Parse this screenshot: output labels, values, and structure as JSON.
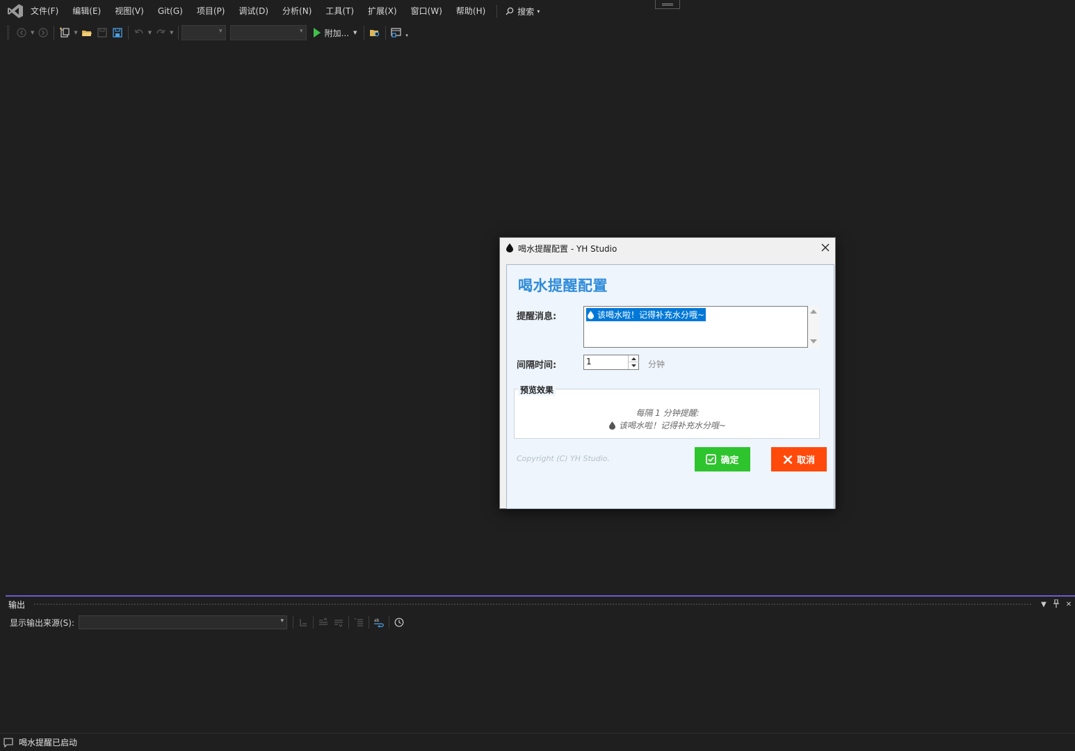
{
  "menubar": {
    "items": [
      "文件(F)",
      "编辑(E)",
      "视图(V)",
      "Git(G)",
      "项目(P)",
      "调试(D)",
      "分析(N)",
      "工具(T)",
      "扩展(X)",
      "窗口(W)",
      "帮助(H)"
    ],
    "search_label": "搜索"
  },
  "toolbar": {
    "run_label": "附加..."
  },
  "dialog": {
    "title": "喝水提醒配置 - YH Studio",
    "heading": "喝水提醒配置",
    "message_label": "提醒消息:",
    "message_value": "该喝水啦！记得补充水分哦~",
    "interval_label": "间隔时间:",
    "interval_value": "1",
    "interval_unit": "分钟",
    "preview_legend": "预览效果",
    "preview_line1": "每隔 1 分钟提醒:",
    "preview_line2": "该喝水啦！记得补充水分哦~",
    "copyright": "Copyright (C) YH Studio.",
    "ok_label": "确定",
    "cancel_label": "取消",
    "colors": {
      "heading": "#2e8bd9",
      "ok": "#2ec42e",
      "cancel": "#ff4a0c",
      "selection": "#0078d7"
    }
  },
  "output": {
    "title": "输出",
    "source_label": "显示输出来源(S):",
    "source_value": ""
  },
  "statusbar": {
    "text": "喝水提醒已启动"
  },
  "colors": {
    "background": "#1f1f1f",
    "panel_accent": "#6d5bd0"
  }
}
